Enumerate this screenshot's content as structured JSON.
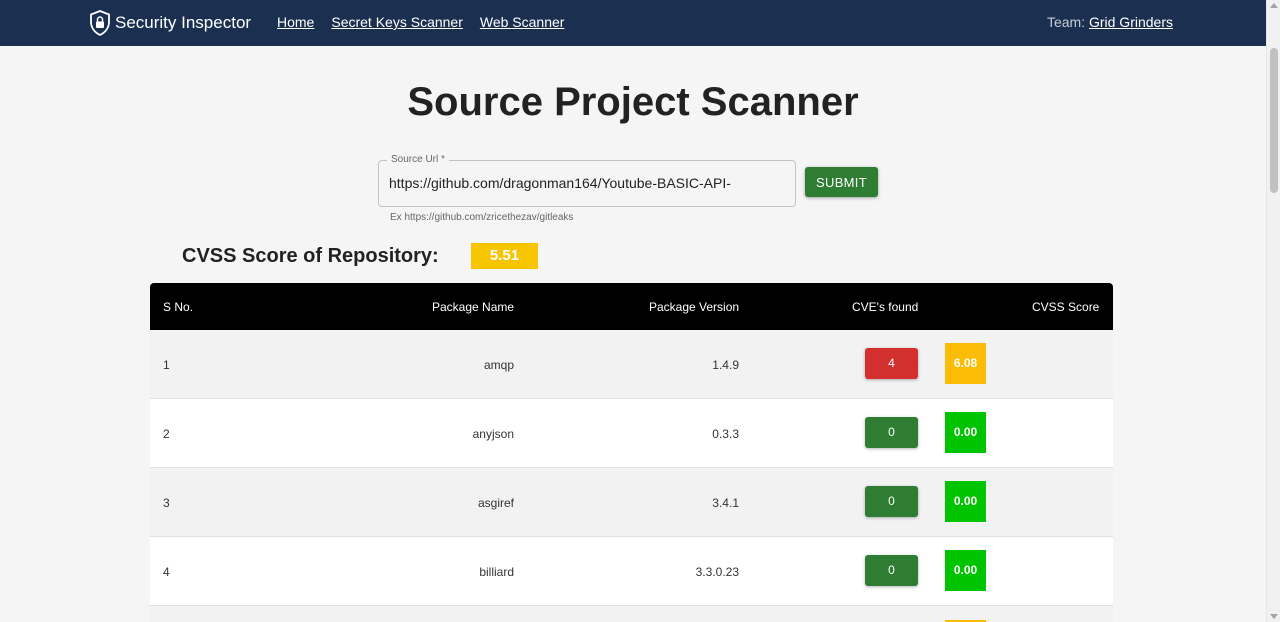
{
  "navbar": {
    "brand": "Security Inspector",
    "links": [
      "Home",
      "Secret Keys Scanner",
      "Web Scanner"
    ],
    "team_label": "Team:",
    "team_name": "Grid Grinders"
  },
  "page": {
    "title": "Source Project Scanner"
  },
  "form": {
    "field_label": "Source Url *",
    "field_value": "https://github.com/dragonman164/Youtube-BASIC-API-",
    "helper_text": "Ex https://github.com/zricethezav/gitleaks",
    "submit_label": "SUBMIT"
  },
  "score": {
    "label": "CVSS Score of Repository:",
    "value": "5.51"
  },
  "table": {
    "headers": [
      "S No.",
      "Package Name",
      "Package Version",
      "CVE's found",
      "CVSS Score"
    ],
    "rows": [
      {
        "sno": "1",
        "name": "amqp",
        "version": "1.4.9",
        "cves": "4",
        "cvss": "6.08",
        "cve_color": "#d32f2f",
        "cvss_color": "#fbbc05"
      },
      {
        "sno": "2",
        "name": "anyjson",
        "version": "0.3.3",
        "cves": "0",
        "cvss": "0.00",
        "cve_color": "#2e7d32",
        "cvss_color": "#00c400"
      },
      {
        "sno": "3",
        "name": "asgiref",
        "version": "3.4.1",
        "cves": "0",
        "cvss": "0.00",
        "cve_color": "#2e7d32",
        "cvss_color": "#00c400"
      },
      {
        "sno": "4",
        "name": "billiard",
        "version": "3.3.0.23",
        "cves": "0",
        "cvss": "0.00",
        "cve_color": "#2e7d32",
        "cvss_color": "#00c400"
      }
    ]
  },
  "colors": {
    "navbar": "#1b3050",
    "accent_green": "#2e7d32",
    "score_yellow": "#f7c400"
  }
}
